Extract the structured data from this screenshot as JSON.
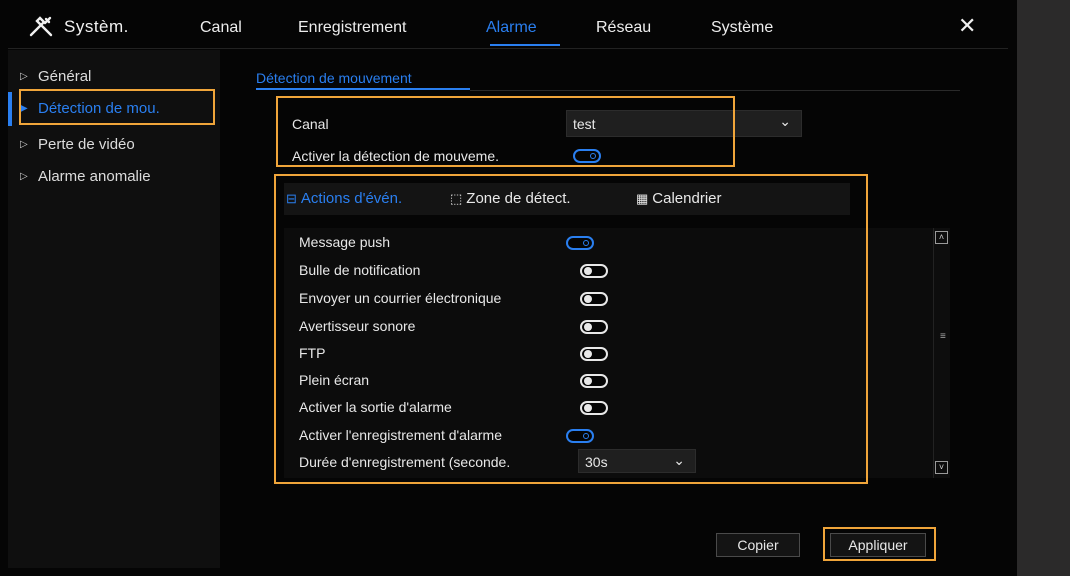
{
  "app": {
    "title": "Systèm."
  },
  "tabs": [
    "Canal",
    "Enregistrement",
    "Alarme",
    "Réseau",
    "Système"
  ],
  "close_label": "✕",
  "sidebar": {
    "items": [
      {
        "label": "Général"
      },
      {
        "label": "Détection de mou."
      },
      {
        "label": "Perte de vidéo"
      },
      {
        "label": "Alarme anomalie"
      }
    ]
  },
  "section": {
    "title": "Détection de mouvement"
  },
  "settings": {
    "channel_label": "Canal",
    "channel_value": "test",
    "enable_label": "Activer la détection de mouveme.",
    "enable_on": true
  },
  "subtabs": [
    {
      "label": "Actions d'évén.",
      "icon": "event-actions-icon"
    },
    {
      "label": "Zone de détect.",
      "icon": "detection-zone-icon"
    },
    {
      "label": "Calendrier",
      "icon": "calendar-icon"
    }
  ],
  "actions": [
    {
      "label": "Message push",
      "on": true
    },
    {
      "label": "Bulle de notification",
      "on": false
    },
    {
      "label": "Envoyer un courrier électronique",
      "on": false
    },
    {
      "label": "Avertisseur sonore",
      "on": false
    },
    {
      "label": "FTP",
      "on": false
    },
    {
      "label": "Plein écran",
      "on": false
    },
    {
      "label": "Activer la sortie d'alarme",
      "on": false
    },
    {
      "label": "Activer l'enregistrement d'alarme",
      "on": true
    }
  ],
  "duration": {
    "label": "Durée d'enregistrement (seconde.",
    "value": "30s"
  },
  "buttons": {
    "copy": "Copier",
    "apply": "Appliquer"
  },
  "colors": {
    "accent": "#2a7ff0",
    "highlight": "#f0a53a",
    "background": "#050505"
  }
}
